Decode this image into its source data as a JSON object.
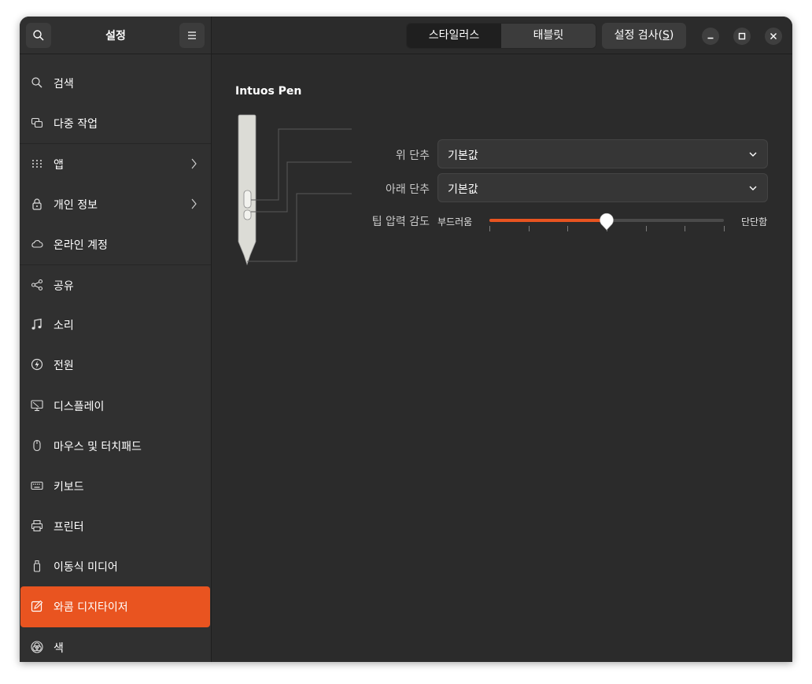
{
  "sidebar": {
    "title": "설정",
    "search_icon": "search-icon",
    "menu_icon": "hamburger-menu-icon",
    "items": [
      {
        "label": "검색",
        "icon": "search-icon"
      },
      {
        "label": "다중 작업",
        "icon": "multitasking-icon"
      },
      {
        "label": "앱",
        "icon": "apps-grid-icon",
        "chevron": true
      },
      {
        "label": "개인 정보",
        "icon": "lock-icon",
        "chevron": true
      },
      {
        "label": "온라인 계정",
        "icon": "cloud-icon"
      },
      {
        "label": "공유",
        "icon": "share-icon"
      },
      {
        "label": "소리",
        "icon": "music-note-icon"
      },
      {
        "label": "전원",
        "icon": "power-icon"
      },
      {
        "label": "디스플레이",
        "icon": "display-icon"
      },
      {
        "label": "마우스 및 터치패드",
        "icon": "mouse-icon"
      },
      {
        "label": "키보드",
        "icon": "keyboard-icon"
      },
      {
        "label": "프린터",
        "icon": "printer-icon"
      },
      {
        "label": "이동식 미디어",
        "icon": "removable-media-icon"
      },
      {
        "label": "와콤 디지타이저",
        "icon": "tablet-pen-icon",
        "active": true
      },
      {
        "label": "색",
        "icon": "color-icon"
      }
    ]
  },
  "header": {
    "tabs": [
      {
        "label": "스타일러스"
      },
      {
        "label": "태블릿"
      }
    ],
    "test_button": {
      "label": "설정 검사(",
      "mnemonic": "S",
      "suffix": ")"
    }
  },
  "stylus": {
    "device_name": "Intuos Pen",
    "upper_button": {
      "label": "위 단추",
      "value": "기본값"
    },
    "lower_button": {
      "label": "아래 단추",
      "value": "기본값"
    },
    "tip_pressure": {
      "label": "팁 압력 감도",
      "min_label": "부드러움",
      "max_label": "단단함",
      "value": 0.5
    }
  },
  "colors": {
    "accent": "#e95420",
    "window_bg": "#2b2b2b",
    "sidebar_bg": "#303030"
  }
}
